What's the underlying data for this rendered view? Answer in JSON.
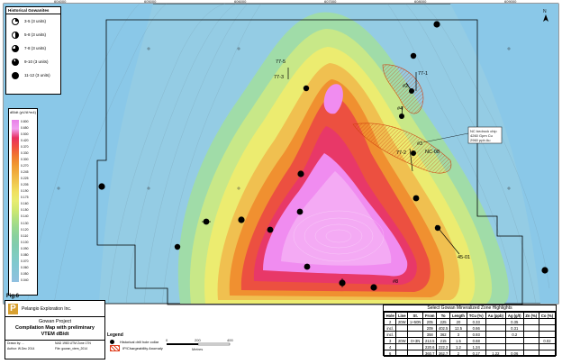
{
  "map": {
    "historical_legend_title": "Historical Gowanites",
    "historical_symbols": [
      {
        "label": "3-5 (3 units)",
        "icon": "quarter-dot-icon"
      },
      {
        "label": "5-8 (3 units)",
        "icon": "half-dot-icon"
      },
      {
        "label": "7-8 (3 units)",
        "icon": "three-quarter-dot-icon"
      },
      {
        "label": "9-10 (3 units)",
        "icon": "near-full-dot-icon"
      },
      {
        "label": "11-12 (3 units)",
        "icon": "full-dot-icon"
      }
    ],
    "vtem_legend_title": "dB/dt (pV/A*m4)",
    "vtem_ticks": [
      "0.800",
      "0.650",
      "0.500",
      "0.420",
      "0.370",
      "0.330",
      "0.300",
      "0.270",
      "0.245",
      "0.225",
      "0.205",
      "0.190",
      "0.175",
      "0.160",
      "0.150",
      "0.140",
      "0.130",
      "0.120",
      "0.110",
      "0.100",
      "0.090",
      "0.080",
      "0.070",
      "0.060",
      "0.050",
      "0.040"
    ],
    "vtem_colors": [
      "#e880e8",
      "#f0a0f0",
      "#e83060",
      "#f05040",
      "#f07830",
      "#f09830",
      "#f0b040",
      "#f0c850",
      "#f0e060",
      "#e8ec70",
      "#d0e870",
      "#b0e080",
      "#98d890",
      "#88d0a0",
      "#80ccb0",
      "#80ccc0",
      "#80c8d0",
      "#88c4d8",
      "#90c0e0"
    ],
    "fig_label": "Fig.6",
    "north_label": "N",
    "drill_labels": [
      {
        "text": "77-5"
      },
      {
        "text": "77-3"
      },
      {
        "text": "77-1"
      },
      {
        "text": "#2"
      },
      {
        "text": "#4"
      },
      {
        "text": "#3"
      },
      {
        "text": "NC-08"
      },
      {
        "text": "77-2"
      },
      {
        "text": "45-01"
      },
      {
        "text": "#8"
      }
    ],
    "callout": [
      "NC bedrock chip",
      "4260 Gpm Cu",
      "2960 ppb Au"
    ],
    "grid_top_labels": [
      "604000",
      "605000",
      "606000",
      "607000",
      "608000",
      "609000"
    ],
    "grid_left_labels": [
      "6258000",
      "6257000",
      "6256000",
      "6255000"
    ],
    "scale_labels": [
      "0",
      "200",
      "400"
    ],
    "scale_unit": "Metres"
  },
  "title_block": {
    "company": "Pelangio Exploration Inc.",
    "logo_letter": "P",
    "project": "Gowan Project",
    "subtitle_1": "Compilation Map with preliminary",
    "subtitle_2": "VTEM dB/dt",
    "meta": [
      "Drawn by: ...",
      "NAD 1983 UTM Zone 17N",
      "Author: W.Dec 2014",
      "File: gowan_vtem_2014"
    ]
  },
  "legend": {
    "title": "Legend",
    "items": [
      {
        "label": "Historical drill hole collar",
        "icon": "drill-collar-icon"
      },
      {
        "label": "IP/Chargeability Anomaly",
        "icon": "ip-anomaly-icon",
        "color": "#e04020"
      }
    ]
  },
  "highlights": {
    "title": "Select Gowan Mineralized Zone Highlights",
    "columns": [
      "Hole",
      "Line",
      "St.",
      "From",
      "To",
      "Length",
      "TCu (%)",
      "Au (ppb)",
      "Ag (g/t)",
      "Zn (%)",
      "Co (%)"
    ],
    "rows": [
      [
        "2",
        "20W",
        "1+50N",
        "205",
        "225",
        "20",
        "0.33",
        "",
        "0.35",
        "",
        ""
      ],
      [
        "incl.",
        "",
        "",
        "209",
        "402.5",
        "12.5",
        "0.66",
        "",
        "0.31",
        "",
        ""
      ],
      [
        "incl.",
        "",
        "",
        "358",
        "362",
        "3",
        "0.93",
        "",
        "0.2",
        "",
        ""
      ],
      [
        "3",
        "20W",
        "0+3N",
        "213.5",
        "215",
        "1.5",
        "0.68",
        "",
        "",
        "",
        "0.02"
      ],
      [
        "4",
        "",
        "",
        "220.6",
        "222.2",
        "1.2",
        "1.24",
        "",
        "",
        "",
        ""
      ],
      [
        "6",
        "",
        "",
        "360.7",
        "362.7",
        "2",
        "0.17",
        "1.22",
        "0.06",
        "",
        ""
      ]
    ]
  }
}
